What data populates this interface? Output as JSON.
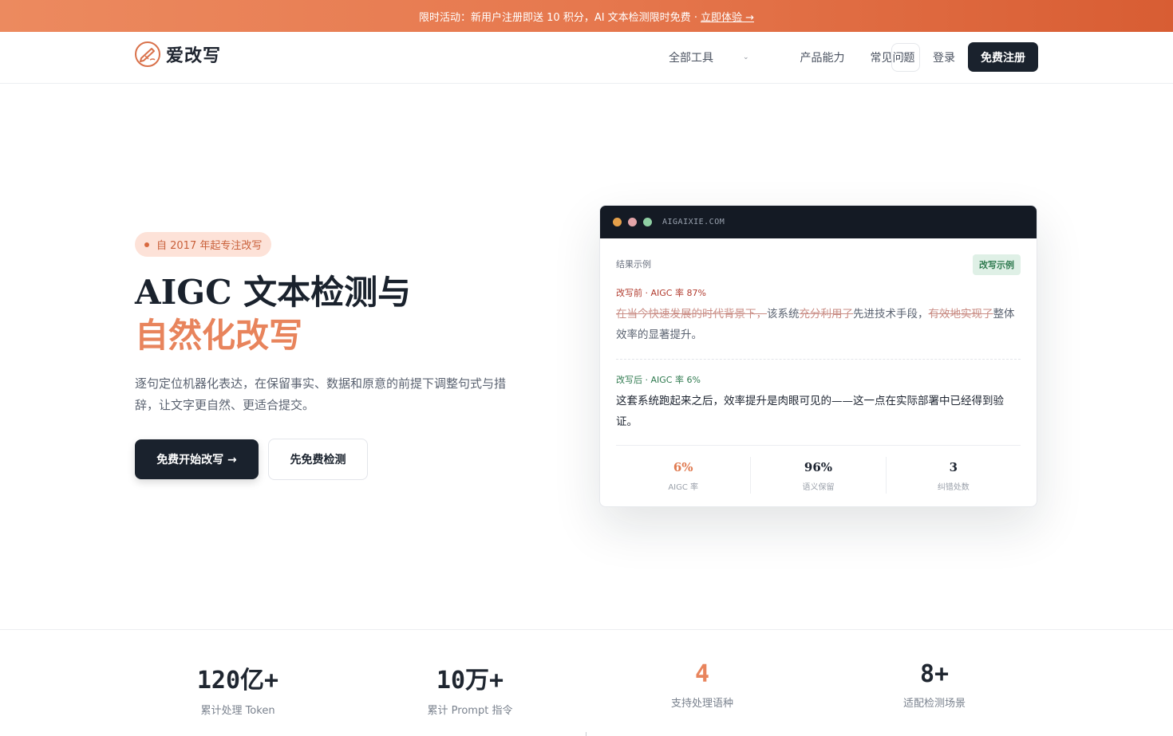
{
  "announcement": {
    "text": "限时活动：新用户注册即送 10 积分，AI 文本检测限时免费 ·",
    "cta": "立即体验 →"
  },
  "nav": {
    "brand": "爱改写",
    "links": [
      "全部工具",
      "产品能力",
      "常见问题"
    ],
    "login": "登录",
    "signup": "免费注册"
  },
  "hero": {
    "badge": "自 2017 年起专注改写",
    "title_line1": "AIGC 文本检测与",
    "title_line2": "自然化改写",
    "description": "逐句定位机器化表达，在保留事实、数据和原意的前提下调整句式与措辞，让文字更自然、更适合提交。",
    "primary_button": "免费开始改写 →",
    "secondary_button": "先免费检测"
  },
  "card": {
    "url": "AIGAIXIE.COM",
    "result_label": "结果示例",
    "tag": "改写示例",
    "before_label": "改写前 · AIGC 率 87%",
    "before_segments": [
      {
        "text": "在当今快速发展的时代背景下，",
        "deleted": true
      },
      {
        "text": "该系统",
        "deleted": false
      },
      {
        "text": "充分利用了",
        "deleted": true
      },
      {
        "text": "先进技术手段，",
        "deleted": false
      },
      {
        "text": "有效地实现了",
        "deleted": true
      },
      {
        "text": "整体效率的显著提升。",
        "deleted": false
      }
    ],
    "after_label": "改写后 · AIGC 率 6%",
    "after_text": "这套系统跑起来之后，效率提升是肉眼可见的——这一点在实际部署中已经得到验证。",
    "stats": [
      {
        "value": "6%",
        "label": "AIGC 率",
        "accent": true
      },
      {
        "value": "96%",
        "label": "语义保留",
        "accent": false
      },
      {
        "value": "3",
        "label": "纠错处数",
        "accent": false
      }
    ]
  },
  "metrics": [
    {
      "value": "120亿+",
      "label": "累计处理 Token",
      "accent": false
    },
    {
      "value": "10万+",
      "label": "累计 Prompt 指令",
      "accent": false
    },
    {
      "value": "4",
      "label": "支持处理语种",
      "accent": true
    },
    {
      "value": "8+",
      "label": "适配检测场景",
      "accent": false
    }
  ],
  "colors": {
    "accent": "#e8845c",
    "dark": "#1a222d",
    "success": "#2f7a4f",
    "danger": "#b13b2e"
  }
}
